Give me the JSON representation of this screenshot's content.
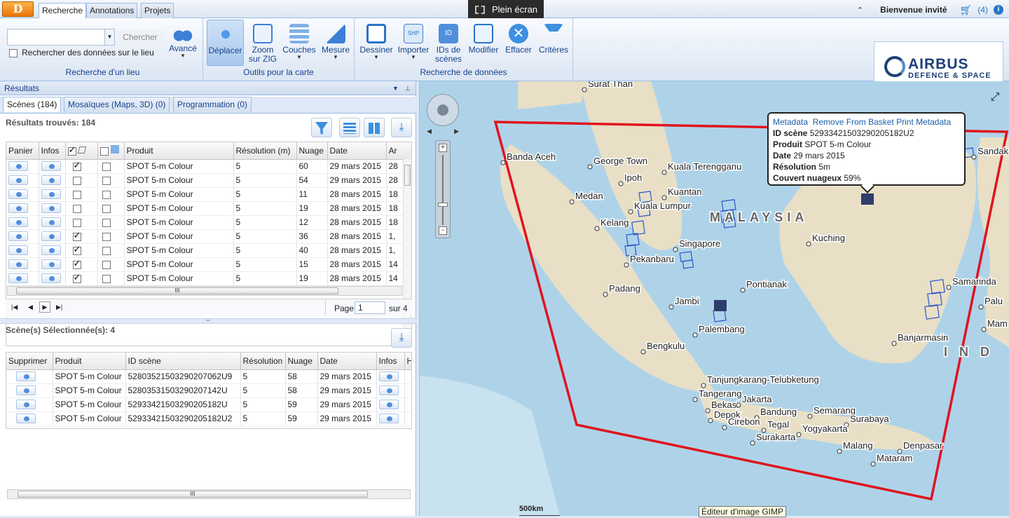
{
  "app": {
    "logo_letter": "D"
  },
  "tabs": [
    "Recherche",
    "Annotations",
    "Projets"
  ],
  "fullscreen_label": "Plein écran",
  "user": {
    "welcome": "Bienvenue invité",
    "basket_count": "(4)"
  },
  "toolbar": {
    "search_placeholder": "",
    "search_button": "Chercher",
    "search_checkbox_label": "Rechercher des données sur le lieu",
    "advanced": "Avancé",
    "group1": "Recherche d'un lieu",
    "move": "Déplacer",
    "zoom": "Zoom sur ZIG",
    "layers": "Couches",
    "measure": "Mesure",
    "group2": "Outils pour la carte",
    "draw": "Dessiner",
    "import": "Importer",
    "ids": "IDs de scènes",
    "modify": "Modifier",
    "erase": "Effacer",
    "criteria": "Critères",
    "group3": "Recherche de données"
  },
  "brand": {
    "name": "AIRBUS",
    "sub": "DEFENCE & SPACE"
  },
  "results": {
    "panel_title": "Résultats",
    "subtabs": [
      "Scènes (184)",
      "Mosaïques (Maps, 3D) (0)",
      "Programmation (0)"
    ],
    "found": "Résultats trouvés: 184",
    "columns": [
      "Panier",
      "Infos",
      "",
      "",
      "Produit",
      "Résolution (m)",
      "Nuage",
      "Date",
      "Ar"
    ],
    "rows": [
      {
        "checked": true,
        "product": "SPOT 5-m Colour",
        "res": "5",
        "cloud": "60",
        "date": "29 mars 2015",
        "ar": "28"
      },
      {
        "checked": false,
        "product": "SPOT 5-m Colour",
        "res": "5",
        "cloud": "54",
        "date": "29 mars 2015",
        "ar": "28"
      },
      {
        "checked": false,
        "product": "SPOT 5-m Colour",
        "res": "5",
        "cloud": "11",
        "date": "28 mars 2015",
        "ar": "18"
      },
      {
        "checked": false,
        "product": "SPOT 5-m Colour",
        "res": "5",
        "cloud": "19",
        "date": "28 mars 2015",
        "ar": "18"
      },
      {
        "checked": false,
        "product": "SPOT 5-m Colour",
        "res": "5",
        "cloud": "12",
        "date": "28 mars 2015",
        "ar": "18"
      },
      {
        "checked": true,
        "product": "SPOT 5-m Colour",
        "res": "5",
        "cloud": "36",
        "date": "28 mars 2015",
        "ar": "1,"
      },
      {
        "checked": true,
        "product": "SPOT 5-m Colour",
        "res": "5",
        "cloud": "40",
        "date": "28 mars 2015",
        "ar": "1,"
      },
      {
        "checked": true,
        "product": "SPOT 5-m Colour",
        "res": "5",
        "cloud": "15",
        "date": "28 mars 2015",
        "ar": "14"
      },
      {
        "checked": true,
        "product": "SPOT 5-m Colour",
        "res": "5",
        "cloud": "19",
        "date": "28 mars 2015",
        "ar": "14"
      }
    ],
    "pager": {
      "page_label": "Page",
      "page": "1",
      "of": "sur 4"
    }
  },
  "selected": {
    "title": "Scène(s) Sélectionnée(s): 4",
    "columns": [
      "Supprimer",
      "Produit",
      "ID scène",
      "Résolution",
      "Nuage",
      "Date",
      "Infos",
      "H"
    ],
    "rows": [
      {
        "product": "SPOT 5-m Colour",
        "id": "52803521503290207062U9",
        "res": "5",
        "cloud": "58",
        "date": "29 mars 2015"
      },
      {
        "product": "SPOT 5-m Colour",
        "id": "52803531503290207142U",
        "res": "5",
        "cloud": "58",
        "date": "29 mars 2015"
      },
      {
        "product": "SPOT 5-m Colour",
        "id": "52933421503290205182U",
        "res": "5",
        "cloud": "59",
        "date": "29 mars 2015"
      },
      {
        "product": "SPOT 5-m Colour",
        "id": "52933421503290205182U2",
        "res": "5",
        "cloud": "59",
        "date": "29 mars 2015"
      }
    ]
  },
  "popup": {
    "links": [
      "Metadata",
      "Remove From Basket",
      "Print Metadata"
    ],
    "id_label": "ID scène",
    "id": "52933421503290205182U2",
    "product_label": "Produit",
    "product": "SPOT 5-m Colour",
    "date_label": "Date",
    "date": "29 mars 2015",
    "res_label": "Résolution",
    "res": "5m",
    "cloud_label": "Couvert nuageux",
    "cloud": "59%"
  },
  "map": {
    "scale": "500km",
    "tooltip": "Éditeur d'image GIMP",
    "places": [
      "Surat Than",
      "Banda Aceh",
      "George Town",
      "Kuala Terengganu",
      "Ipoh",
      "Kuantan",
      "Medan",
      "Kuala Lumpur",
      "MALAYSIA",
      "Kelang",
      "Singapore",
      "Pekanbaru",
      "Kuching",
      "Padang",
      "Pontianak",
      "Jambi",
      "Palembang",
      "Bengkulu",
      "Samarinda",
      "Palu",
      "Mam",
      "Banjarmasin",
      "I N D",
      "Sandakan",
      "Tanjungkarang-Telubketung",
      "Tangerang",
      "Bekasi",
      "Jakarta",
      "Depok",
      "Bandung",
      "Semarang",
      "Cirebon",
      "Tegal",
      "Surabaya",
      "Yogyakarta",
      "Surakarta",
      "Malang",
      "Denpasar",
      "Mataram"
    ],
    "colors": {
      "aoi": "#e0141e",
      "footprint": "#2a57c8",
      "sea": "#a9cfe6",
      "land": "#e6dcc0"
    }
  }
}
